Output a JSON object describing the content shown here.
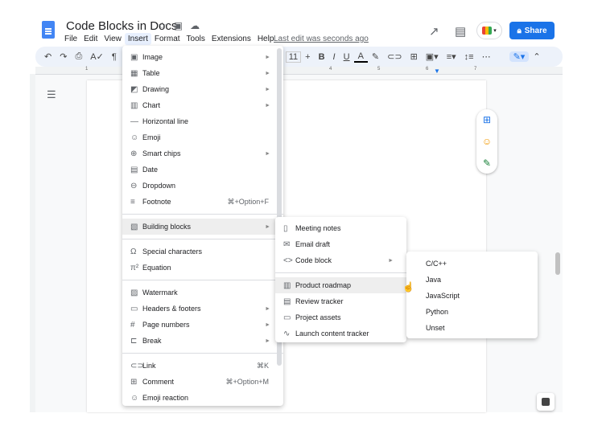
{
  "header": {
    "title": "Code Blocks in Docs",
    "title_icons": [
      "star-icon",
      "folder-icon",
      "cloud-icon"
    ],
    "menu": [
      "File",
      "Edit",
      "View",
      "Insert",
      "Format",
      "Tools",
      "Extensions",
      "Help"
    ],
    "last_edit": "Last edit was seconds ago",
    "share": "Share"
  },
  "toolbar": {
    "font_size": "11",
    "plus": "+",
    "bold": "B",
    "italic": "I",
    "underline": "U",
    "color": "A",
    "more": "⋯"
  },
  "ruler": [
    "1",
    "4",
    "5",
    "6",
    "7"
  ],
  "insert_menu": [
    {
      "icon": "▣",
      "label": "Image",
      "arrow": "►"
    },
    {
      "icon": "▦",
      "label": "Table",
      "arrow": "►"
    },
    {
      "icon": "◩",
      "label": "Drawing",
      "arrow": "►"
    },
    {
      "icon": "▥",
      "label": "Chart",
      "arrow": "►"
    },
    {
      "icon": "—",
      "label": "Horizontal line"
    },
    {
      "icon": "☺",
      "label": "Emoji"
    },
    {
      "icon": "⊕",
      "label": "Smart chips",
      "arrow": "►"
    },
    {
      "icon": "▤",
      "label": "Date"
    },
    {
      "icon": "⊖",
      "label": "Dropdown"
    },
    {
      "icon": "≡",
      "label": "Footnote",
      "shortcut": "⌘+Option+F"
    },
    {
      "sep": true
    },
    {
      "icon": "▧",
      "label": "Building blocks",
      "arrow": "►",
      "highlight": true
    },
    {
      "sep": true
    },
    {
      "icon": "Ω",
      "label": "Special characters"
    },
    {
      "icon": "π²",
      "label": "Equation"
    },
    {
      "sep": true
    },
    {
      "icon": "▨",
      "label": "Watermark"
    },
    {
      "icon": "▭",
      "label": "Headers & footers",
      "arrow": "►"
    },
    {
      "icon": "#",
      "label": "Page numbers",
      "arrow": "►"
    },
    {
      "icon": "⊏",
      "label": "Break",
      "arrow": "►"
    },
    {
      "sep": true
    },
    {
      "icon": "⊂⊃",
      "label": "Link",
      "shortcut": "⌘K"
    },
    {
      "icon": "⊞",
      "label": "Comment",
      "shortcut": "⌘+Option+M"
    },
    {
      "icon": "☺",
      "label": "Emoji reaction"
    }
  ],
  "building_blocks": [
    {
      "icon": "▯",
      "label": "Meeting notes"
    },
    {
      "icon": "✉",
      "label": "Email draft"
    },
    {
      "icon": "<>",
      "label": "Code block",
      "arrow": "►"
    },
    {
      "sep": true
    },
    {
      "icon": "▥",
      "label": "Product roadmap",
      "highlight": true
    },
    {
      "icon": "▤",
      "label": "Review tracker"
    },
    {
      "icon": "▭",
      "label": "Project assets"
    },
    {
      "icon": "∿",
      "label": "Launch content tracker"
    }
  ],
  "code_block": [
    "C/C++",
    "Java",
    "JavaScript",
    "Python",
    "Unset"
  ],
  "colors": {
    "accent": "#1a73e8"
  }
}
